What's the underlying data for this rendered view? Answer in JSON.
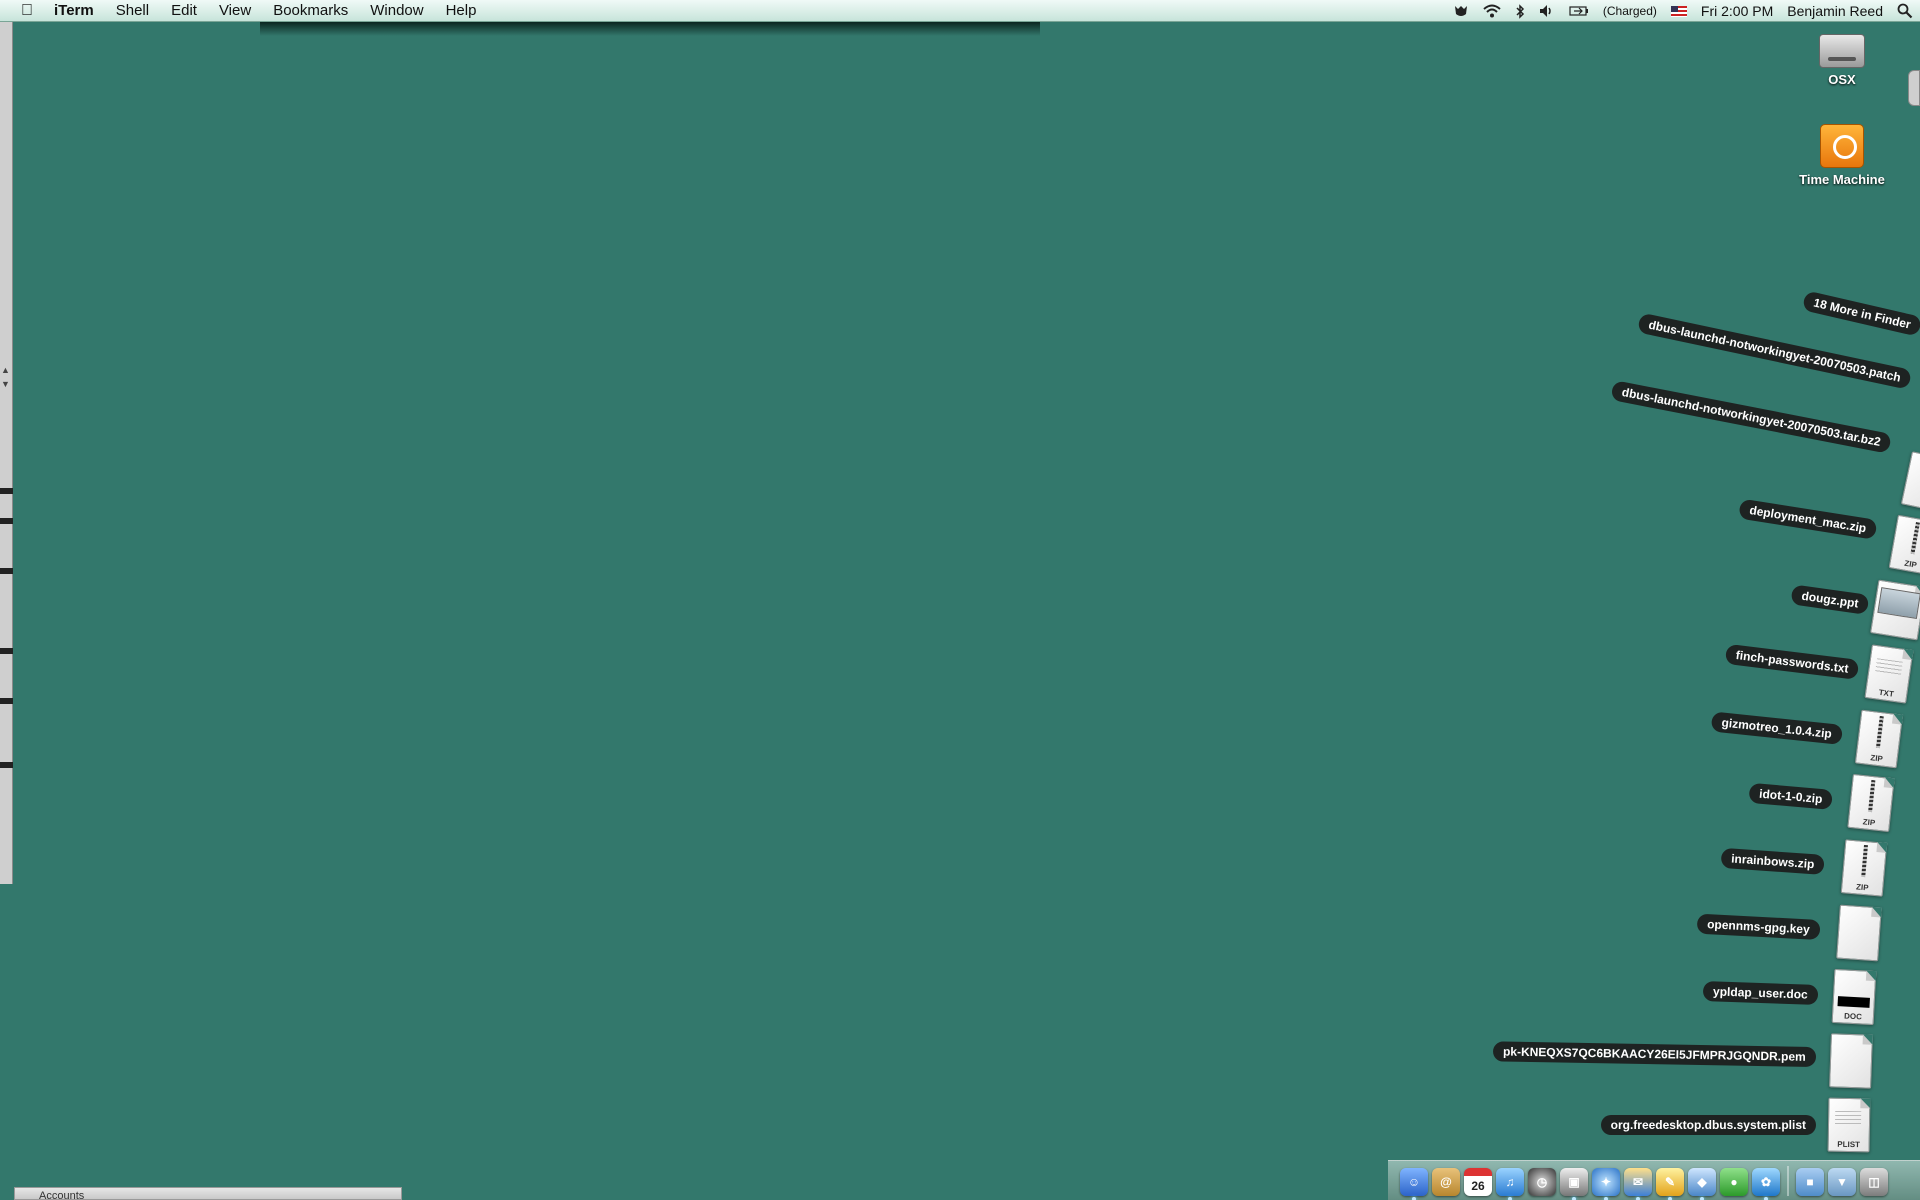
{
  "menubar": {
    "app_name": "iTerm",
    "menus": [
      "Shell",
      "Edit",
      "View",
      "Bookmarks",
      "Window",
      "Help"
    ],
    "status": {
      "battery": "(Charged)",
      "clock": "Fri 2:00 PM",
      "user": "Benjamin Reed"
    }
  },
  "desktop": {
    "icons": [
      {
        "label": "OSX",
        "icon": "hard-drive-icon"
      },
      {
        "label": "Time Machine",
        "icon": "time-machine-icon"
      }
    ]
  },
  "stack": {
    "more_label": "18 More in Finder",
    "items": [
      {
        "name": "dbus-launchd-notworkingyet-20070503.patch",
        "type": ""
      },
      {
        "name": "dbus-launchd-notworkingyet-20070503.tar.bz2",
        "type": ""
      },
      {
        "name": "deployment_mac.zip",
        "type": "ZIP"
      },
      {
        "name": "dougz.ppt",
        "type": ""
      },
      {
        "name": "finch-passwords.txt",
        "type": "TXT"
      },
      {
        "name": "gizmotreo_1.0.4.zip",
        "type": "ZIP"
      },
      {
        "name": "idot-1-0.zip",
        "type": "ZIP"
      },
      {
        "name": "inrainbows.zip",
        "type": "ZIP"
      },
      {
        "name": "opennms-gpg.key",
        "type": ""
      },
      {
        "name": "ypldap_user.doc",
        "type": "DOC"
      },
      {
        "name": "pk-KNEQXS7QC6BKAACY26EI5JFMPRJGQNDR.pem",
        "type": ""
      },
      {
        "name": "org.freedesktop.dbus.system.plist",
        "type": "PLIST"
      }
    ]
  },
  "dock": {
    "calendar_day": "26",
    "items": [
      "finder-icon",
      "address-book-icon",
      "ical-icon",
      "itunes-icon",
      "time-machine-icon",
      "photo-icon",
      "safari-icon",
      "mail-icon",
      "pen-icon",
      "preview-icon",
      "adium-icon",
      "twitter-icon",
      "folder-icon",
      "downloads-icon",
      "trash-icon"
    ]
  },
  "bottom_window": {
    "title": "Accounts"
  }
}
